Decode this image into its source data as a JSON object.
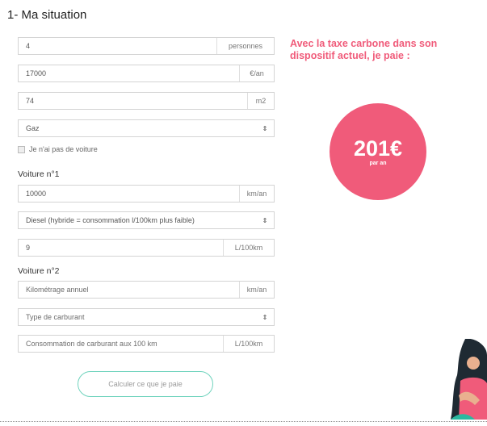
{
  "section_title": "1- Ma situation",
  "fields": {
    "personnes": {
      "value": "4",
      "unit": "personnes"
    },
    "revenu": {
      "value": "17000",
      "unit": "€/an"
    },
    "surface": {
      "value": "74",
      "unit": "m2"
    },
    "chauffage": {
      "value": "Gaz"
    }
  },
  "no_car_label": "Je n'ai pas de voiture",
  "car1": {
    "heading": "Voiture n°1",
    "km": {
      "value": "10000",
      "unit": "km/an"
    },
    "fuel": {
      "value": "Diesel (hybride = consommation l/100km plus faible)"
    },
    "consumption": {
      "value": "9",
      "unit": "L/100km"
    }
  },
  "car2": {
    "heading": "Voiture n°2",
    "km": {
      "placeholder": "Kilométrage annuel",
      "unit": "km/an"
    },
    "fuel": {
      "placeholder": "Type de carburant"
    },
    "consumption": {
      "placeholder": "Consommation de carburant aux 100 km",
      "unit": "L/100km"
    }
  },
  "calc_button": "Calculer ce que je paie",
  "result": {
    "headline": "Avec la taxe carbone dans son dispositif actuel, je paie :",
    "amount": "201€",
    "period": "par an"
  },
  "caret_glyph": "⇕",
  "colors": {
    "accent": "#f05b7a",
    "button_border": "#6fd3bd"
  }
}
